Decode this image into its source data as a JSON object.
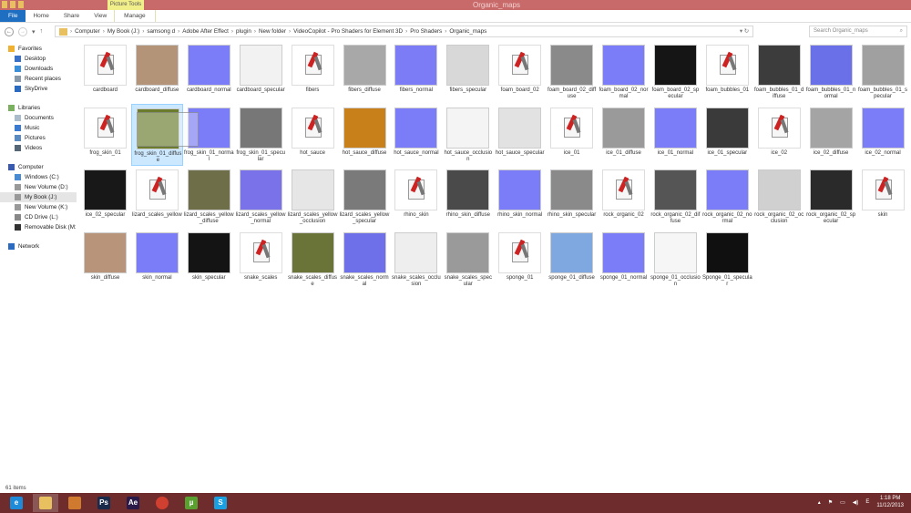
{
  "window": {
    "title": "Organic_maps",
    "context_tab": "Picture Tools"
  },
  "ribbon": {
    "tabs": [
      "File",
      "Home",
      "Share",
      "View",
      "Manage"
    ]
  },
  "address": {
    "crumbs": [
      "Computer",
      "My Book (J:)",
      "samsong d",
      "Adobe After Effect",
      "plugin",
      "New folder",
      "VideoCopilot - Pro Shaders for Element 3D",
      "Pro Shaders",
      "Organic_maps"
    ],
    "search_placeholder": "Search Organic_maps"
  },
  "sidebar": {
    "items": [
      {
        "label": "Favorites",
        "level": 1,
        "icon": "star-icon",
        "color": "#f0b030"
      },
      {
        "label": "Desktop",
        "level": 2,
        "icon": "desktop-icon",
        "color": "#3a6fc8"
      },
      {
        "label": "Downloads",
        "level": 2,
        "icon": "downloads-icon",
        "color": "#3a8fd8"
      },
      {
        "label": "Recent places",
        "level": 2,
        "icon": "recent-places-icon",
        "color": "#8899aa"
      },
      {
        "label": "SkyDrive",
        "level": 2,
        "icon": "skydrive-icon",
        "color": "#2a6ac0"
      },
      {
        "gap": true
      },
      {
        "label": "Libraries",
        "level": 1,
        "icon": "libraries-icon",
        "color": "#7ab060"
      },
      {
        "label": "Documents",
        "level": 2,
        "icon": "documents-icon",
        "color": "#aabbcc"
      },
      {
        "label": "Music",
        "level": 2,
        "icon": "music-icon",
        "color": "#3a7ad0"
      },
      {
        "label": "Pictures",
        "level": 2,
        "icon": "pictures-icon",
        "color": "#5a8ac0"
      },
      {
        "label": "Videos",
        "level": 2,
        "icon": "videos-icon",
        "color": "#556677"
      },
      {
        "gap": true
      },
      {
        "label": "Computer",
        "level": 1,
        "icon": "computer-icon",
        "color": "#3a5ab0"
      },
      {
        "label": "Windows (C:)",
        "level": 2,
        "icon": "drive-icon",
        "color": "#4a8ad0"
      },
      {
        "label": "New Volume (D:)",
        "level": 2,
        "icon": "drive-icon",
        "color": "#999999"
      },
      {
        "label": "My Book (J:)",
        "level": 2,
        "icon": "drive-icon",
        "color": "#999999",
        "selected": true
      },
      {
        "label": "New Volume (K:)",
        "level": 2,
        "icon": "drive-icon",
        "color": "#999999"
      },
      {
        "label": "CD Drive (L:)",
        "level": 2,
        "icon": "cd-drive-icon",
        "color": "#888888"
      },
      {
        "label": "Removable Disk (M:",
        "level": 2,
        "icon": "usb-drive-icon",
        "color": "#333333"
      },
      {
        "gap": true
      },
      {
        "label": "Network",
        "level": 1,
        "icon": "network-icon",
        "color": "#2a6ac0"
      }
    ]
  },
  "files": [
    {
      "name": "cardboard",
      "thumb": "doc"
    },
    {
      "name": "cardboard_diffuse",
      "thumb": "#b49478"
    },
    {
      "name": "cardboard_normal",
      "thumb": "#7b7cf7"
    },
    {
      "name": "cardboard_specular",
      "thumb": "#f2f2f2"
    },
    {
      "name": "fibers",
      "thumb": "doc"
    },
    {
      "name": "fibers_diffuse",
      "thumb": "#a8a8a8"
    },
    {
      "name": "fibers_normal",
      "thumb": "#7c7df6"
    },
    {
      "name": "fibers_specular",
      "thumb": "#d8d8d8"
    },
    {
      "name": "foam_board_02",
      "thumb": "doc"
    },
    {
      "name": "foam_board_02_diffuse",
      "thumb": "#8a8a8a"
    },
    {
      "name": "foam_board_02_normal",
      "thumb": "#7b7cf7"
    },
    {
      "name": "foam_board_02_specular",
      "thumb": "#151515"
    },
    {
      "name": "foam_bubbles_01",
      "thumb": "doc"
    },
    {
      "name": "foam_bubbles_01_diffuse",
      "thumb": "#3c3c3c"
    },
    {
      "name": "foam_bubbles_01_normal",
      "thumb": "#6a70e8"
    },
    {
      "name": "foam_bubbles_01_specular",
      "thumb": "#a0a0a0"
    },
    {
      "name": "frog_skin_01",
      "thumb": "doc"
    },
    {
      "name": "frog_skin_01_diffuse",
      "thumb": "#6b7d2c",
      "selected": true
    },
    {
      "name": "frog_skin_01_normal",
      "thumb": "#7b7cf7"
    },
    {
      "name": "frog_skin_01_specular",
      "thumb": "#777777"
    },
    {
      "name": "hot_sauce",
      "thumb": "doc"
    },
    {
      "name": "hot_sauce_diffuse",
      "thumb": "#c8801a"
    },
    {
      "name": "hot_sauce_normal",
      "thumb": "#7b7cf7"
    },
    {
      "name": "hot_sauce_occlusion",
      "thumb": "#f4f4f4"
    },
    {
      "name": "hot_sauce_specular",
      "thumb": "#e2e2e2"
    },
    {
      "name": "ice_01",
      "thumb": "doc"
    },
    {
      "name": "ice_01_diffuse",
      "thumb": "#9a9a9a"
    },
    {
      "name": "ice_01_normal",
      "thumb": "#7b7cf7"
    },
    {
      "name": "ice_01_specular",
      "thumb": "#3a3a3a"
    },
    {
      "name": "ice_02",
      "thumb": "doc"
    },
    {
      "name": "ice_02_diffuse",
      "thumb": "#a4a4a4"
    },
    {
      "name": "ice_02_normal",
      "thumb": "#7b7cf7"
    },
    {
      "name": "ice_02_specular",
      "thumb": "#181818"
    },
    {
      "name": "lizard_scales_yellow",
      "thumb": "doc"
    },
    {
      "name": "lizard_scales_yellow_diffuse",
      "thumb": "#6e6e48"
    },
    {
      "name": "lizard_scales_yellow_normal",
      "thumb": "#7a72e8"
    },
    {
      "name": "lizard_scales_yellow_occlusion",
      "thumb": "#e6e6e6"
    },
    {
      "name": "lizard_scales_yellow_specular",
      "thumb": "#7a7a7a"
    },
    {
      "name": "rhino_skin",
      "thumb": "doc"
    },
    {
      "name": "rhino_skin_diffuse",
      "thumb": "#4a4a4a"
    },
    {
      "name": "rhino_skin_normal",
      "thumb": "#7b7cf7"
    },
    {
      "name": "rhino_skin_specular",
      "thumb": "#8a8a8a"
    },
    {
      "name": "rock_organic_02",
      "thumb": "doc"
    },
    {
      "name": "rock_organic_02_diffuse",
      "thumb": "#555555"
    },
    {
      "name": "rock_organic_02_normal",
      "thumb": "#7b7cf7"
    },
    {
      "name": "rock_organic_02_occlusion",
      "thumb": "#d0d0d0"
    },
    {
      "name": "rock_organic_02_specular",
      "thumb": "#2a2a2a"
    },
    {
      "name": "skin",
      "thumb": "doc"
    },
    {
      "name": "skin_diffuse",
      "thumb": "#b8957a"
    },
    {
      "name": "skin_normal",
      "thumb": "#7b7cf7"
    },
    {
      "name": "skin_specular",
      "thumb": "#141414"
    },
    {
      "name": "snake_scales",
      "thumb": "doc"
    },
    {
      "name": "snake_scales_diffuse",
      "thumb": "#6a7438"
    },
    {
      "name": "snake_scales_normal",
      "thumb": "#6e70ea"
    },
    {
      "name": "snake_scales_occlusion",
      "thumb": "#eeeeee"
    },
    {
      "name": "snake_scales_specular",
      "thumb": "#9a9a9a"
    },
    {
      "name": "sponge_01",
      "thumb": "doc"
    },
    {
      "name": "sponge_01_diffuse",
      "thumb": "#80a8e0"
    },
    {
      "name": "sponge_01_normal",
      "thumb": "#7b7cf7"
    },
    {
      "name": "sponge_01_occlusion",
      "thumb": "#f6f6f6"
    },
    {
      "name": "Sponge_01_specular",
      "thumb": "#101010"
    }
  ],
  "status": {
    "count": "61 items"
  },
  "taskbar": {
    "apps": [
      {
        "name": "internet-explorer",
        "glyph": "e",
        "color": "#1e8ad8"
      },
      {
        "name": "file-explorer",
        "glyph": "",
        "color": "#e8c060",
        "active": true
      },
      {
        "name": "app",
        "glyph": "",
        "color": "#d07a30"
      },
      {
        "name": "photoshop",
        "glyph": "Ps",
        "color": "#1a2a4a"
      },
      {
        "name": "after-effects",
        "glyph": "Ae",
        "color": "#2a1a4a"
      },
      {
        "name": "chrome",
        "glyph": "",
        "color": "#d04030"
      },
      {
        "name": "utorrent",
        "glyph": "µ",
        "color": "#5aa030"
      },
      {
        "name": "skype",
        "glyph": "S",
        "color": "#1aa0e0"
      }
    ],
    "lang": "E",
    "time": "1:18 PM",
    "date": "11/12/2013"
  }
}
